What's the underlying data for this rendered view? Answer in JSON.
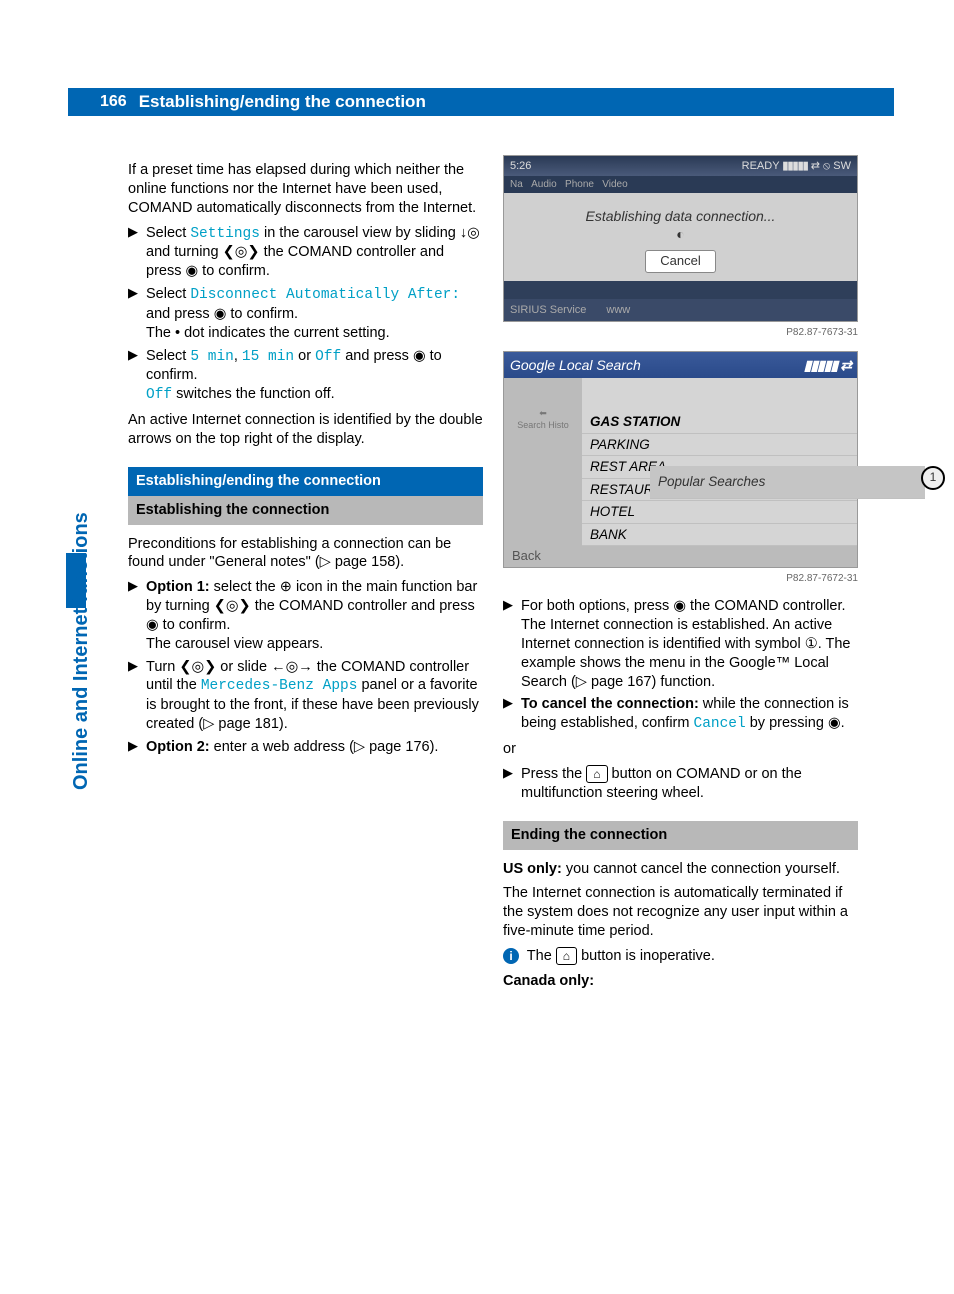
{
  "page_number": "166",
  "header_title": "Establishing/ending the connection",
  "side_tab": "Online and Internet functions",
  "left": {
    "intro": "If a preset time has elapsed during which neither the online functions nor the Internet have been used, COMAND automatically disconnects from the Internet.",
    "step1_a": "Select ",
    "step1_cyan": "Settings",
    "step1_b": " in the carousel view by sliding ",
    "step1_c": " and turning ",
    "step1_d": " the COMAND controller and press ",
    "step1_e": " to confirm.",
    "step2_a": "Select ",
    "step2_cyan": "Disconnect Automatically After:",
    "step2_b": " and press ",
    "step2_c": " to confirm.",
    "step2_d": "The • dot indicates the current setting.",
    "step3_a": "Select ",
    "step3_cyan1": "5 min",
    "step3_sep1": ", ",
    "step3_cyan2": "15 min",
    "step3_sep2": " or ",
    "step3_cyan3": "Off",
    "step3_b": " and press ",
    "step3_c": " to confirm.",
    "step3_cyan4": "Off",
    "step3_d": " switches the function off.",
    "para2": "An active Internet connection is identified by the double arrows on the top right of the display.",
    "sec_dark": "Establishing/ending the connection",
    "sec_light": "Establishing the connection",
    "precond": "Preconditions for establishing a connection can be found under \"General notes\" (▷ page 158).",
    "opt1_bold": "Option 1:",
    "opt1_a": " select the ",
    "opt1_b": " icon in the main function bar by turning ",
    "opt1_c": " the COMAND controller and press ",
    "opt1_d": " to confirm.",
    "opt1_e": "The carousel view appears.",
    "turn_a": "Turn ",
    "turn_b": " or slide ",
    "turn_c": " the COMAND controller until the ",
    "turn_cyan": "Mercedes-Benz Apps",
    "turn_d": " panel or a favorite is brought to the front, if these have been previously created (▷ page 181).",
    "opt2_bold": "Option 2:",
    "opt2_a": " enter a web address (▷ page 176)."
  },
  "ss1": {
    "time": "5:26",
    "ready": "READY",
    "sw": "SW",
    "dialog": "Establishing data connection...",
    "cancel": "Cancel",
    "sirius": "SIRIUS Service",
    "www": "www",
    "code": "P82.87-7673-31"
  },
  "ss2": {
    "title": "Google Local Search",
    "popular": "Popular Searches",
    "items": [
      "GAS STATION",
      "PARKING",
      "REST AREA",
      "RESTAURANT",
      "HOTEL",
      "BANK"
    ],
    "left_label": "Search Histo",
    "back": "Back",
    "circle": "1",
    "code": "P82.87-7672-31"
  },
  "right": {
    "both_a": "For both options, press ",
    "both_b": " the COMAND controller.",
    "both_c": "The Internet connection is established. An active Internet connection is identified with symbol ①. The example shows the menu in the Google™ Local Search (▷ page 167) function.",
    "cancel_bold": "To cancel the connection:",
    "cancel_a": " while the connection is being established, confirm ",
    "cancel_cyan": "Cancel",
    "cancel_b": " by pressing ",
    "cancel_c": ".",
    "or": "or",
    "press_a": "Press the ",
    "press_b": " button on COMAND or on the multifunction steering wheel.",
    "sec_light2": "Ending the connection",
    "us_bold": "US only:",
    "us_a": " you cannot cancel the connection yourself.",
    "us_b": "The Internet connection is automatically terminated if the system does not recognize any user input within a five-minute time period.",
    "info_a": "The ",
    "info_b": " button is inoperative.",
    "canada_bold": "Canada only:"
  },
  "glyphs": {
    "marker": "▶",
    "slide_down": "↓◎",
    "turn": "❮◎❯",
    "press": "◉",
    "globe": "⊕",
    "slide_lr": "←◎→",
    "back_icon": "⌂",
    "info": "i"
  }
}
